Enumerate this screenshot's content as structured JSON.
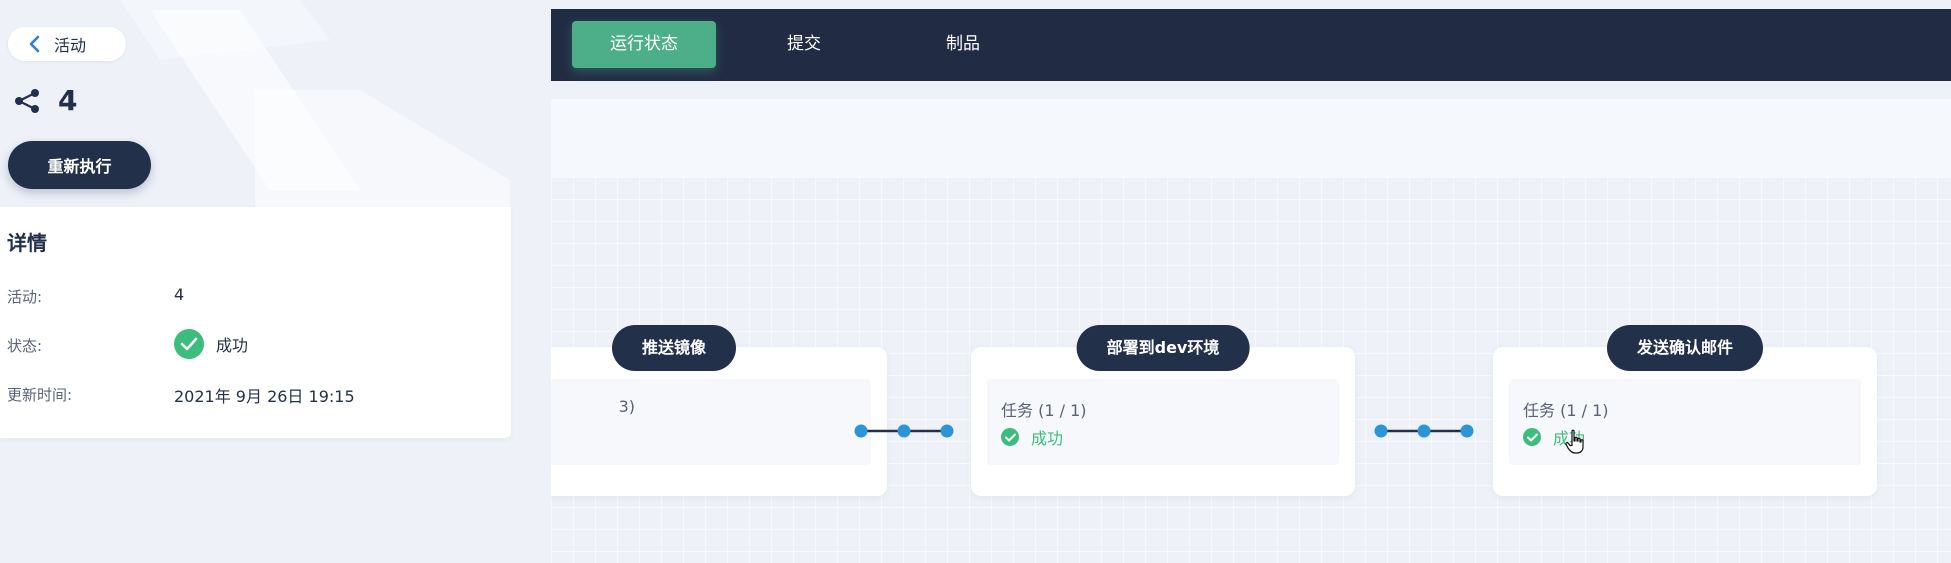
{
  "header": {
    "back_label": "活动",
    "run_number": "4",
    "rerun_label": "重新执行"
  },
  "details": {
    "title": "详情",
    "rows": [
      {
        "label": "活动:",
        "value": "4"
      },
      {
        "label": "状态:",
        "value": "成功"
      },
      {
        "label": "更新时间:",
        "value": "2021年 9月 26日 19:15"
      }
    ]
  },
  "tabs": [
    {
      "label": "运行状态",
      "active": true
    },
    {
      "label": "提交",
      "active": false
    },
    {
      "label": "制品",
      "active": false
    }
  ],
  "pipeline": {
    "stages": [
      {
        "name": "推送镜像",
        "task_count": "3)",
        "status": ""
      },
      {
        "name": "部署到dev环境",
        "task_count": "任务 (1 / 1)",
        "status": "成功"
      },
      {
        "name": "发送确认邮件",
        "task_count": "任务 (1 / 1)",
        "status": "成功"
      }
    ]
  },
  "colors": {
    "navy": "#23304a",
    "accent_green": "#4caf8a",
    "success": "#3dbd7d",
    "connector_dot": "#2d95d6"
  },
  "icons": {
    "back": "chevron-left-icon",
    "run": "share-nodes-icon",
    "success": "check-circle-icon",
    "cursor": "hand-pointer-icon"
  }
}
